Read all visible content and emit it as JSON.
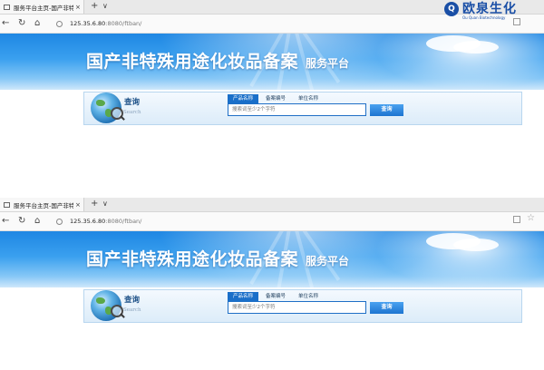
{
  "browser": {
    "tab_title": "服务平台主页-国产非特",
    "tab_close": "×",
    "new_tab": "+",
    "tab_menu": "∨",
    "url_host": "125.35.6.80",
    "url_path": ":8080/ftban/"
  },
  "icons": {
    "back": "back-arrow-icon",
    "reload": "reload-icon",
    "home": "home-icon",
    "info": "site-info-icon",
    "reader": "reading-view-icon",
    "favorite": "favorite-star-icon"
  },
  "banner": {
    "title": "国产非特殊用途化妆品备案",
    "subtitle": "服务平台"
  },
  "search": {
    "label_cn": "查询",
    "label_en": "Search",
    "tabs": [
      {
        "label": "产品名称",
        "active": true
      },
      {
        "label": "备案编号",
        "active": false
      },
      {
        "label": "单位名称",
        "active": false
      }
    ],
    "placeholder": "搜索词至少2个字符",
    "button": "查询"
  },
  "watermark": {
    "name": "欧泉生化",
    "sub": "Ou Quan Biotechnology"
  },
  "colors": {
    "accent": "#1a6fc9",
    "banner_blue": "#1f87e3",
    "logo_blue": "#1a4fa6"
  }
}
